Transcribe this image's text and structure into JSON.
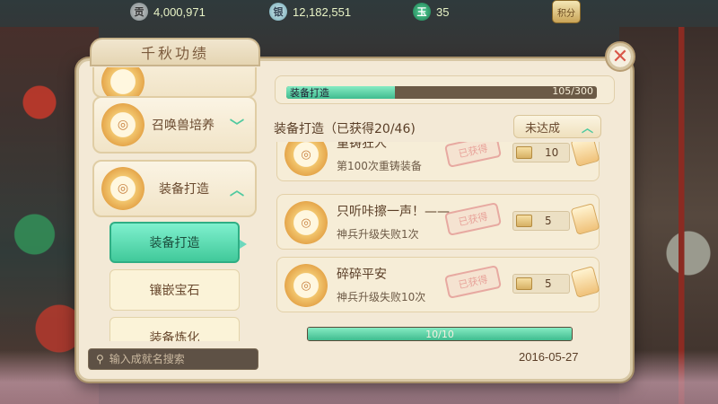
{
  "topbar": {
    "silver": {
      "icon": "silver-coin-icon",
      "icon_char": "贡",
      "value": "4,000,971"
    },
    "coins": {
      "icon": "ingot-icon",
      "icon_char": "银",
      "value": "12,182,551"
    },
    "jade": {
      "icon": "jade-icon",
      "icon_char": "玉",
      "value": "35"
    },
    "score_button": "积分"
  },
  "panel": {
    "title": "千秋功绩",
    "close_label": "✕"
  },
  "categories": [
    {
      "label": "召唤兽培养",
      "chevron": "﹀",
      "expanded": false
    },
    {
      "label": "装备打造",
      "chevron": "︿",
      "expanded": true
    }
  ],
  "subcategories": [
    {
      "label": "装备打造",
      "active": true
    },
    {
      "label": "镶嵌宝石",
      "active": false
    },
    {
      "label": "装备炼化",
      "active": false
    }
  ],
  "search": {
    "placeholder": "输入成就名搜索"
  },
  "overall_progress": {
    "label": "装备打造",
    "count": "105/300",
    "fraction": 0.35
  },
  "section": {
    "title": "装备打造（已获得20/46)",
    "status_button": "未达成",
    "status_chevron": "︿"
  },
  "achievements": [
    {
      "name": "重铸狂人",
      "desc": "第100次重铸装备",
      "stamp": "已获得",
      "reward": "10"
    },
    {
      "name": "只听咔擦一声！——",
      "desc": "神兵升级失败1次",
      "stamp": "已获得",
      "reward": "5"
    },
    {
      "name": "碎碎平安",
      "desc": "神兵升级失败10次",
      "stamp": "已获得",
      "reward": "5"
    }
  ],
  "category_progress": {
    "text": "10/10",
    "fraction": 1.0
  },
  "date": "2016-05-27",
  "colors": {
    "accent": "#41c99a",
    "panel_bg": "#f3e9d6",
    "stamp": "#e8a49b"
  }
}
